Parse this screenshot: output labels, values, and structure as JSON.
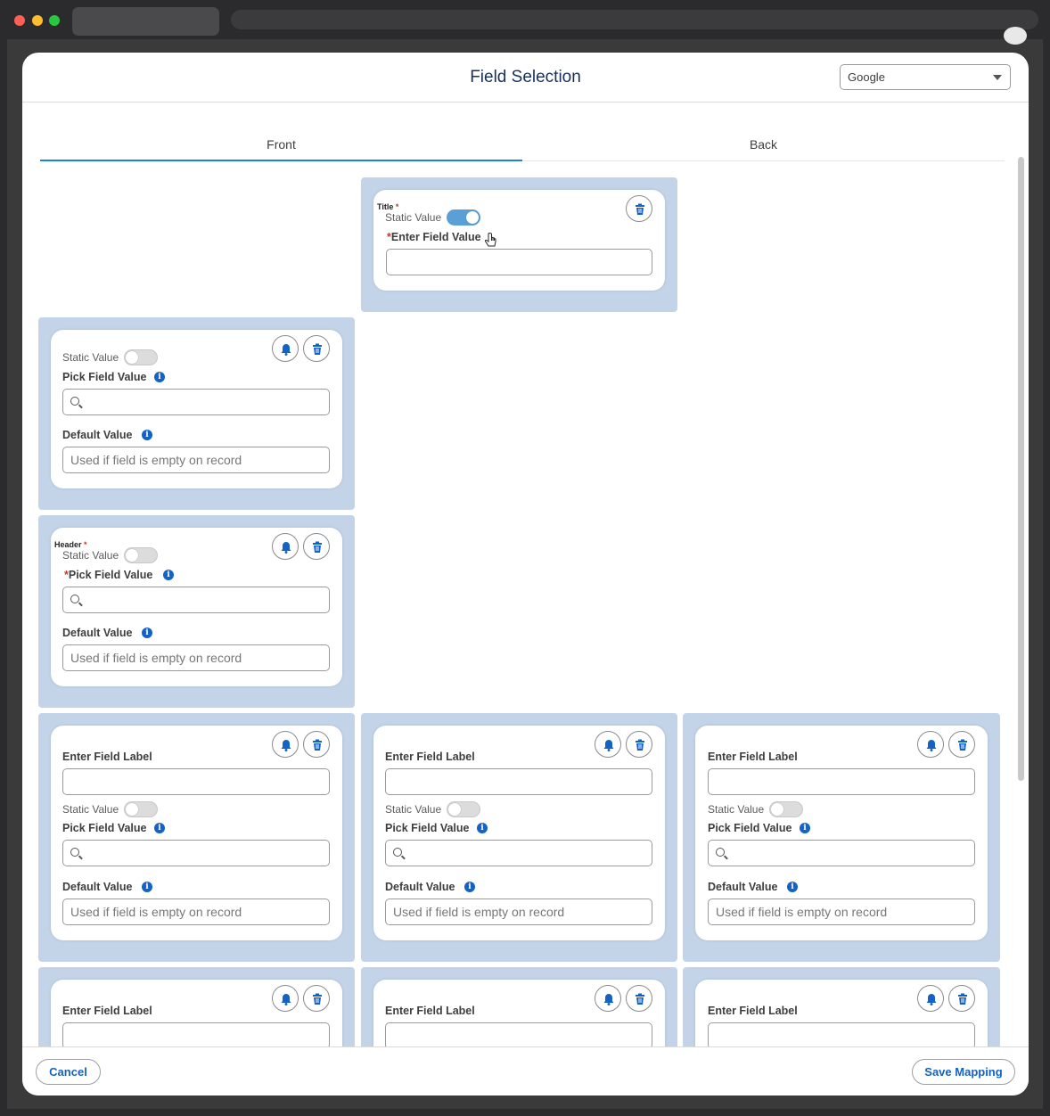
{
  "window": {
    "controls": [
      "close",
      "minimize",
      "zoom"
    ]
  },
  "modal": {
    "title": "Field Selection",
    "select_value": "Google",
    "tabs": [
      {
        "label": "Front",
        "active": true
      },
      {
        "label": "Back",
        "active": false
      }
    ]
  },
  "labels": {
    "title": "Title",
    "header": "Header",
    "required_mark": "*",
    "static_value": "Static Value",
    "enter_field_value": "Enter Field Value",
    "pick_field_value": "Pick Field Value",
    "default_value": "Default Value",
    "enter_field_label": "Enter Field Label",
    "default_placeholder": "Used if field is empty on record",
    "info_glyph": "i"
  },
  "cards": {
    "title_card": {
      "static_value_on": true
    },
    "field_card_1": {
      "static_value_on": false
    },
    "header_card": {
      "static_value_on": false
    }
  },
  "footer": {
    "cancel_label": "Cancel",
    "save_label": "Save Mapping"
  },
  "colors": {
    "accent": "#1462c4",
    "slot_bg": "#c3d4e8",
    "required": "#c23934",
    "toggle_on": "#5a9fd6"
  },
  "icons": [
    "bell-icon",
    "trash-icon",
    "search-icon",
    "info-icon",
    "chevron-down-icon",
    "hand-cursor-icon"
  ]
}
